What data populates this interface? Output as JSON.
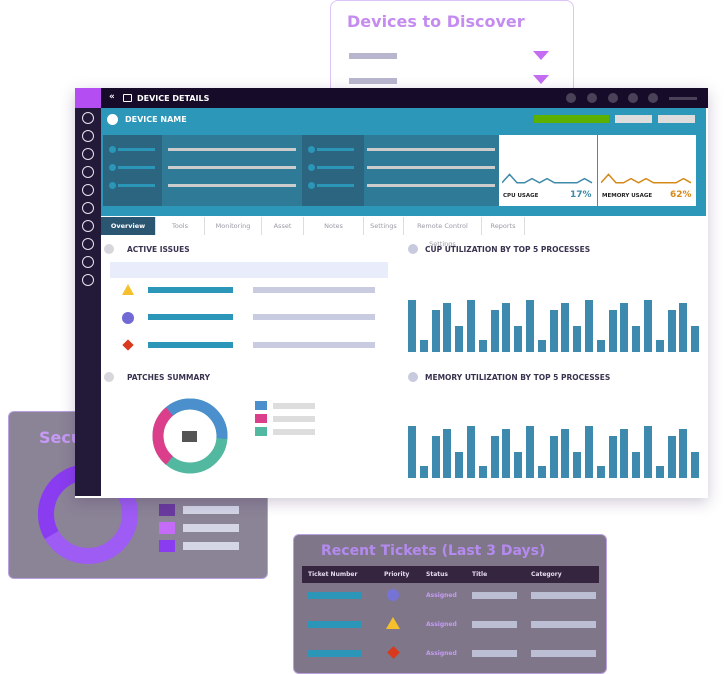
{
  "devices_card": {
    "title": "Devices to Discover",
    "rows": 2
  },
  "security_card": {
    "title": "Security",
    "donut_colors": [
      "#9e5cf5",
      "#8a3cf0",
      "#6a3a9e"
    ],
    "legend_colors": [
      "#b86cf5",
      "#6a3a9e",
      "#c46cf7",
      "#8a3cf0"
    ]
  },
  "tickets_card": {
    "title": "Recent Tickets (Last 3 Days)",
    "columns": [
      "Ticket Number",
      "Priority",
      "Status",
      "Title",
      "Category"
    ],
    "rows": [
      {
        "priority": "circle",
        "status": "Assigned"
      },
      {
        "priority": "triangle",
        "status": "Assigned"
      },
      {
        "priority": "diamond",
        "status": "Assigned"
      }
    ]
  },
  "header": {
    "back_icon": "double-chevron-left",
    "device_icon": "devices-icon",
    "title": "DEVICE DETAILS"
  },
  "device": {
    "name": "DEVICE NAME",
    "status_color": "#5cb000"
  },
  "cpu": {
    "label": "CPU USAGE",
    "value": "17%",
    "color": "#3e8aa8",
    "spark": [
      3,
      9,
      3,
      3,
      6,
      3,
      6,
      3,
      3,
      3,
      3,
      6,
      3
    ]
  },
  "memory": {
    "label": "MEMORY USAGE",
    "value": "62%",
    "color": "#d48a1a",
    "spark": [
      3,
      9,
      3,
      3,
      6,
      3,
      6,
      3,
      3,
      3,
      3,
      6,
      3
    ]
  },
  "tabs": [
    "Overview",
    "Tools",
    "Monitoring",
    "Asset",
    "Notes",
    "Settings",
    "Remote Control Settings",
    "Reports"
  ],
  "active_tab": "Overview",
  "sections": {
    "active_issues": "ACTIVE ISSUES",
    "patches": "PATCHES SUMMARY",
    "cpu_top": "CUP UTILIZATION BY TOP 5 PROCESSES",
    "mem_top": "MEMORY UTILIZATION BY TOP 5 PROCESSES"
  },
  "issue_icons": [
    "triangle",
    "circle",
    "diamond"
  ],
  "patches_colors": [
    "#4b8fcc",
    "#db3f8c",
    "#52b8a0"
  ],
  "chart_data": [
    {
      "type": "bar",
      "title": "CUP UTILIZATION BY TOP 5 PROCESSES",
      "values": [
        43,
        10,
        35,
        41,
        22,
        43,
        10,
        35,
        41,
        22,
        43,
        10,
        35,
        41,
        22,
        43,
        10,
        35,
        41,
        22,
        43,
        10,
        35,
        41,
        22
      ],
      "color": "#3e8aae"
    },
    {
      "type": "bar",
      "title": "MEMORY UTILIZATION BY TOP 5 PROCESSES",
      "values": [
        43,
        10,
        35,
        41,
        22,
        43,
        10,
        35,
        41,
        22,
        43,
        10,
        35,
        41,
        22,
        43,
        10,
        35,
        41,
        22,
        43,
        10,
        35,
        41,
        22
      ],
      "color": "#3e8aae"
    }
  ]
}
